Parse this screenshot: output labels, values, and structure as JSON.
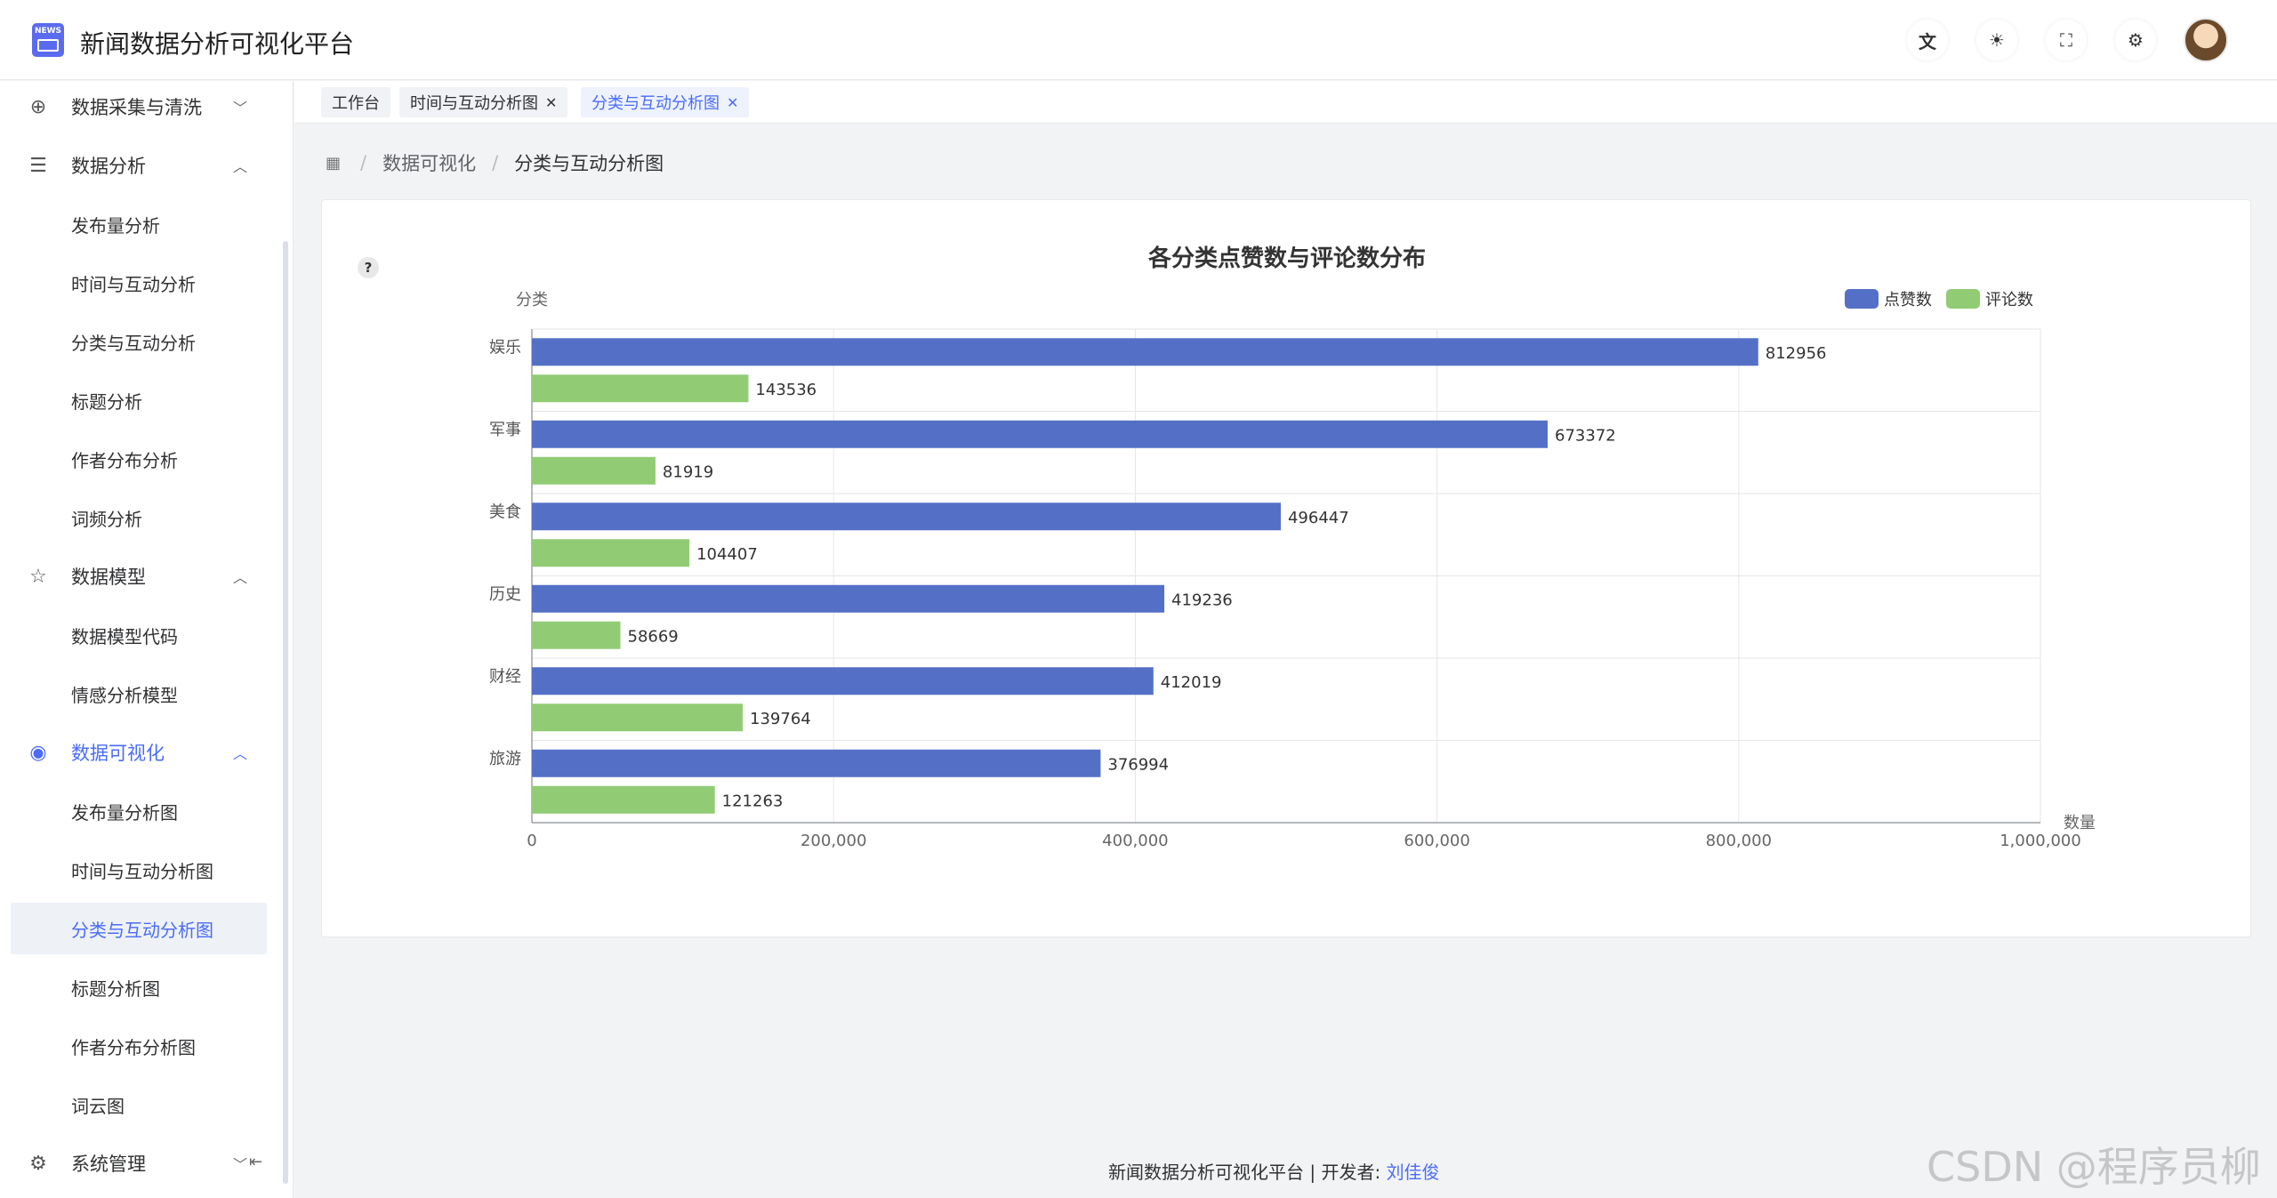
{
  "header": {
    "logo_text": "NEWS",
    "title": "新闻数据分析可视化平台",
    "buttons": [
      "translate-icon",
      "theme-icon",
      "fullscreen-icon",
      "settings-icon"
    ]
  },
  "sidebar": {
    "groups": [
      {
        "label": "数据采集与清洗",
        "icon": "plus-circle-icon",
        "expanded": false,
        "items": []
      },
      {
        "label": "数据分析",
        "icon": "list-indent-icon",
        "expanded": true,
        "items": [
          "发布量分析",
          "时间与互动分析",
          "分类与互动分析",
          "标题分析",
          "作者分布分析",
          "词频分析"
        ]
      },
      {
        "label": "数据模型",
        "icon": "star-icon",
        "expanded": true,
        "items": [
          "数据模型代码",
          "情感分析模型"
        ]
      },
      {
        "label": "数据可视化",
        "icon": "eye-icon",
        "expanded": true,
        "active": true,
        "items": [
          "发布量分析图",
          "时间与互动分析图",
          "分类与互动分析图",
          "标题分析图",
          "作者分布分析图",
          "词云图"
        ]
      },
      {
        "label": "系统管理",
        "icon": "gear-icon",
        "expanded": false,
        "items": []
      }
    ],
    "active_item": "分类与互动分析图"
  },
  "tabs": [
    {
      "label": "工作台",
      "closable": false
    },
    {
      "label": "时间与互动分析图",
      "closable": true
    },
    {
      "label": "分类与互动分析图",
      "closable": true,
      "active": true
    }
  ],
  "breadcrumb": [
    "数据可视化",
    "分类与互动分析图"
  ],
  "chart_data": {
    "type": "bar",
    "orientation": "horizontal",
    "title": "各分类点赞数与评论数分布",
    "ylabel": "分类",
    "xlabel": "数量",
    "categories": [
      "娱乐",
      "军事",
      "美食",
      "历史",
      "财经",
      "旅游"
    ],
    "series": [
      {
        "name": "点赞数",
        "color": "#5470c6",
        "values": [
          812956,
          673372,
          496447,
          419236,
          412019,
          376994
        ]
      },
      {
        "name": "评论数",
        "color": "#91cc75",
        "values": [
          143536,
          81919,
          104407,
          58669,
          139764,
          121263
        ]
      }
    ],
    "xlim": [
      0,
      1000000
    ],
    "xticks": [
      "0",
      "200,000",
      "400,000",
      "600,000",
      "800,000",
      "1,000,000"
    ],
    "grid": true,
    "legend": "top-right",
    "data_labels": true
  },
  "footer": {
    "text": "新闻数据分析可视化平台 | 开发者:",
    "developer": "刘佳俊"
  },
  "watermark": "CSDN @程序员柳"
}
